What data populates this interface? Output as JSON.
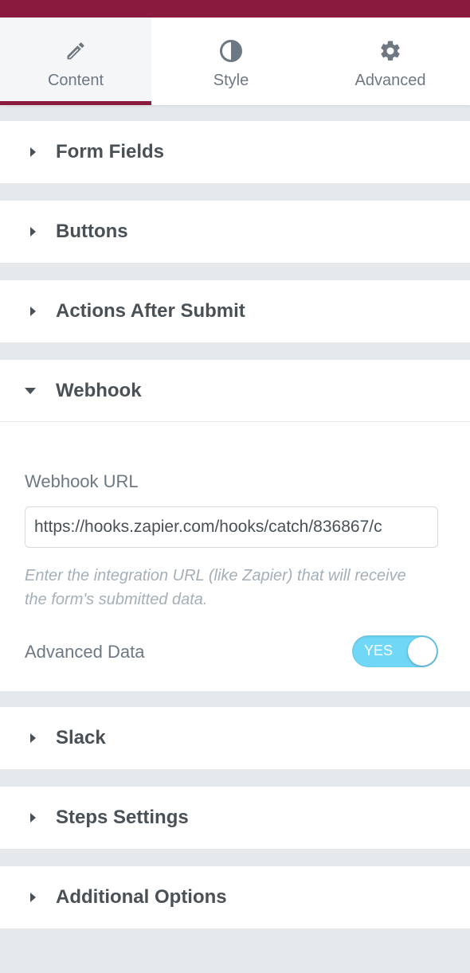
{
  "colors": {
    "accent": "#8b1a3f",
    "toggle_on": "#71d7f7",
    "panel_bg": "#e6e9ec"
  },
  "tabs": [
    {
      "label": "Content",
      "icon": "pencil-icon",
      "active": true
    },
    {
      "label": "Style",
      "icon": "half-circle-icon",
      "active": false
    },
    {
      "label": "Advanced",
      "icon": "gear-icon",
      "active": false
    }
  ],
  "sections": {
    "form_fields": "Form Fields",
    "buttons": "Buttons",
    "actions_after_submit": "Actions After Submit",
    "webhook": "Webhook",
    "slack": "Slack",
    "steps_settings": "Steps Settings",
    "additional_options": "Additional Options"
  },
  "webhook": {
    "url_label": "Webhook URL",
    "url_value": "https://hooks.zapier.com/hooks/catch/836867/c",
    "help_text": "Enter the integration URL (like Zapier) that will receive the form's submitted data.",
    "advanced_data_label": "Advanced Data",
    "advanced_data_toggle": "YES"
  }
}
